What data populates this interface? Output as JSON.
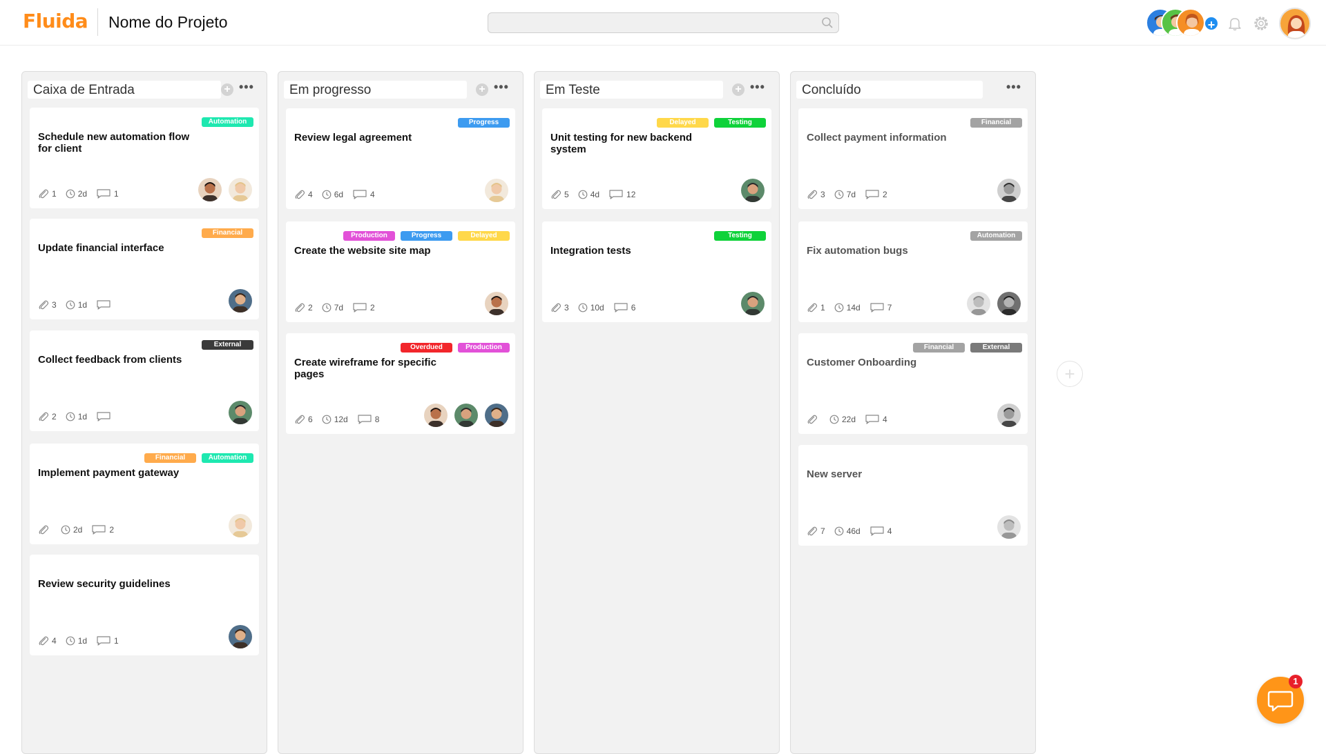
{
  "app": {
    "logo": "Fluida",
    "project_title": "Nome do Projeto"
  },
  "search": {
    "placeholder": "",
    "value": ""
  },
  "header": {
    "add_member_label": "+"
  },
  "colors": {
    "brand": "#ff8c1a",
    "Automation": "#1ee8b0",
    "Financial": "#ffab4c",
    "External": "#3a3a3a",
    "Progress": "#3d9bf0",
    "Production": "#e251d8",
    "Delayed": "#ffd84a",
    "Testing": "#0fd23a",
    "Overdued": "#f2262b",
    "done_tag": "#a3a3a3"
  },
  "columns": [
    {
      "title": "Caixa de Entrada",
      "cards": [
        {
          "title": "Schedule new automation flow for client",
          "tags": [
            "Automation"
          ],
          "attachments": "1",
          "time": "2d",
          "comments": "1",
          "avatars": [
            "man-dark",
            "woman-blonde"
          ]
        },
        {
          "title": "Update financial interface",
          "tags": [
            "Financial"
          ],
          "attachments": "3",
          "time": "1d",
          "comments": "",
          "avatars": [
            "man-beard"
          ]
        },
        {
          "title": "Collect feedback from clients",
          "tags": [
            "External"
          ],
          "attachments": "2",
          "time": "1d",
          "comments": "",
          "avatars": [
            "man-cap"
          ]
        },
        {
          "title": "Implement payment gateway",
          "tags": [
            "Financial",
            "Automation"
          ],
          "attachments": "",
          "time": "2d",
          "comments": "2",
          "avatars": [
            "woman-blonde"
          ]
        },
        {
          "title": "Review security guidelines",
          "tags": [],
          "attachments": "4",
          "time": "1d",
          "comments": "1",
          "avatars": [
            "man-beard"
          ]
        }
      ]
    },
    {
      "title": "Em progresso",
      "cards": [
        {
          "title": "Review legal agreement",
          "tags": [
            "Progress"
          ],
          "attachments": "4",
          "time": "6d",
          "comments": "4",
          "avatars": [
            "woman-blonde"
          ]
        },
        {
          "title": "Create the website site map",
          "tags": [
            "Production",
            "Progress",
            "Delayed"
          ],
          "attachments": "2",
          "time": "7d",
          "comments": "2",
          "avatars": [
            "man-dark"
          ]
        },
        {
          "title": "Create wireframe for specific pages",
          "tags": [
            "Overdued",
            "Production"
          ],
          "attachments": "6",
          "time": "12d",
          "comments": "8",
          "avatars": [
            "man-dark",
            "man-cap",
            "man-beard"
          ]
        }
      ]
    },
    {
      "title": "Em Teste",
      "cards": [
        {
          "title": "Unit testing for new backend system",
          "tags": [
            "Delayed",
            "Testing"
          ],
          "attachments": "5",
          "time": "4d",
          "comments": "12",
          "avatars": [
            "man-cap"
          ]
        },
        {
          "title": "Integration tests",
          "tags": [
            "Testing"
          ],
          "attachments": "3",
          "time": "10d",
          "comments": "6",
          "avatars": [
            "man-cap"
          ]
        }
      ]
    },
    {
      "title": "Concluído",
      "cards": [
        {
          "title": "Collect payment information",
          "tags": [
            "Financial"
          ],
          "attachments": "3",
          "time": "7d",
          "comments": "2",
          "avatars": [
            "man-gray"
          ]
        },
        {
          "title": "Fix automation bugs",
          "tags": [
            "Automation"
          ],
          "attachments": "1",
          "time": "14d",
          "comments": "7",
          "avatars": [
            "woman-gray",
            "man-gray-beard"
          ]
        },
        {
          "title": "Customer Onboarding",
          "tags": [
            "Financial",
            "External"
          ],
          "attachments": "",
          "time": "22d",
          "comments": "4",
          "avatars": [
            "man-gray"
          ]
        },
        {
          "title": "New server",
          "tags": [],
          "attachments": "7",
          "time": "46d",
          "comments": "4",
          "avatars": [
            "woman-gray"
          ]
        }
      ]
    }
  ],
  "add_column_label": "+",
  "chat": {
    "unread_count": "1"
  }
}
